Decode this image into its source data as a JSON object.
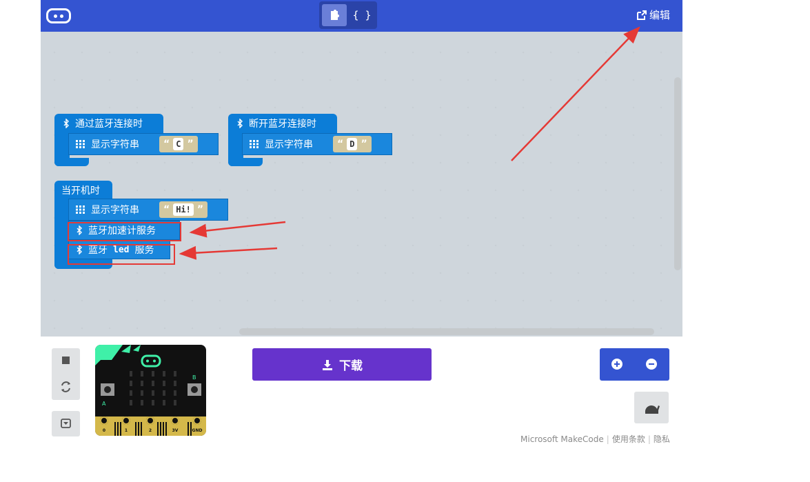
{
  "toolbar": {
    "blocks_icon": "puzzle-icon",
    "js_label": "{ }",
    "edit_label": "编辑",
    "accent": "#3454d1"
  },
  "workspace": {
    "blocks": [
      {
        "hat": "通过蓝牙连接时",
        "children": [
          {
            "label": "显示字符串",
            "value": "C"
          }
        ]
      },
      {
        "hat": "断开蓝牙连接时",
        "children": [
          {
            "label": "显示字符串",
            "value": "D"
          }
        ]
      },
      {
        "hat": "当开机时",
        "children": [
          {
            "label": "显示字符串",
            "value": "Hi!"
          },
          {
            "label": "蓝牙加速计服务"
          },
          {
            "label_parts": [
              "蓝牙",
              "led",
              "服务"
            ]
          }
        ]
      }
    ],
    "block_color": "#0c7dd7",
    "string_color": "#d3c8a0",
    "annotation_color": "#e53935"
  },
  "simulator": {
    "pins": [
      "0",
      "1",
      "2",
      "3V",
      "GND"
    ],
    "side_label_b": "B",
    "side_label_a": "A"
  },
  "download": {
    "label": "下载",
    "color": "#6633cc"
  },
  "footer": {
    "brand": "Microsoft MakeCode",
    "terms": "使用条款",
    "privacy": "隐私"
  }
}
